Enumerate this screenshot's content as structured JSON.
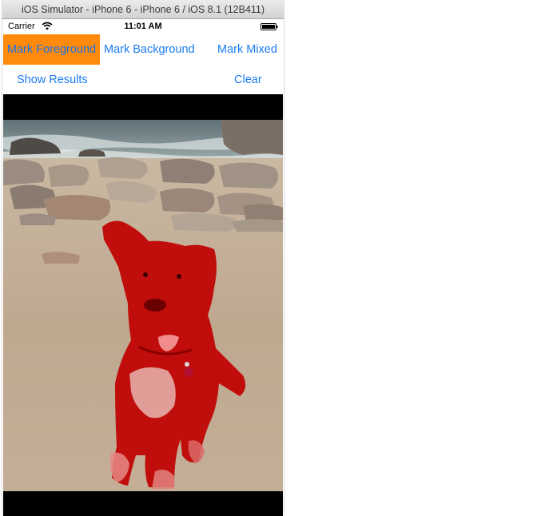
{
  "window": {
    "title": "iOS Simulator - iPhone 6 - iPhone 6 / iOS 8.1 (12B411)"
  },
  "status_bar": {
    "carrier": "Carrier",
    "time": "11:01 AM",
    "wifi_icon": "wifi-icon",
    "battery_icon": "battery-icon"
  },
  "toolbar": {
    "mark_foreground": "Mark Foreground",
    "mark_background": "Mark Background",
    "mark_mixed": "Mark Mixed",
    "show_results": "Show Results",
    "clear": "Clear",
    "selected": "mark_foreground"
  },
  "colors": {
    "button_text": "#1a7cf2",
    "selected_button_background": "#ff8a0c",
    "foreground_mask": "#c00000",
    "letterbox": "#000000"
  },
  "photo": {
    "subject_mask_color": "#c00000"
  }
}
